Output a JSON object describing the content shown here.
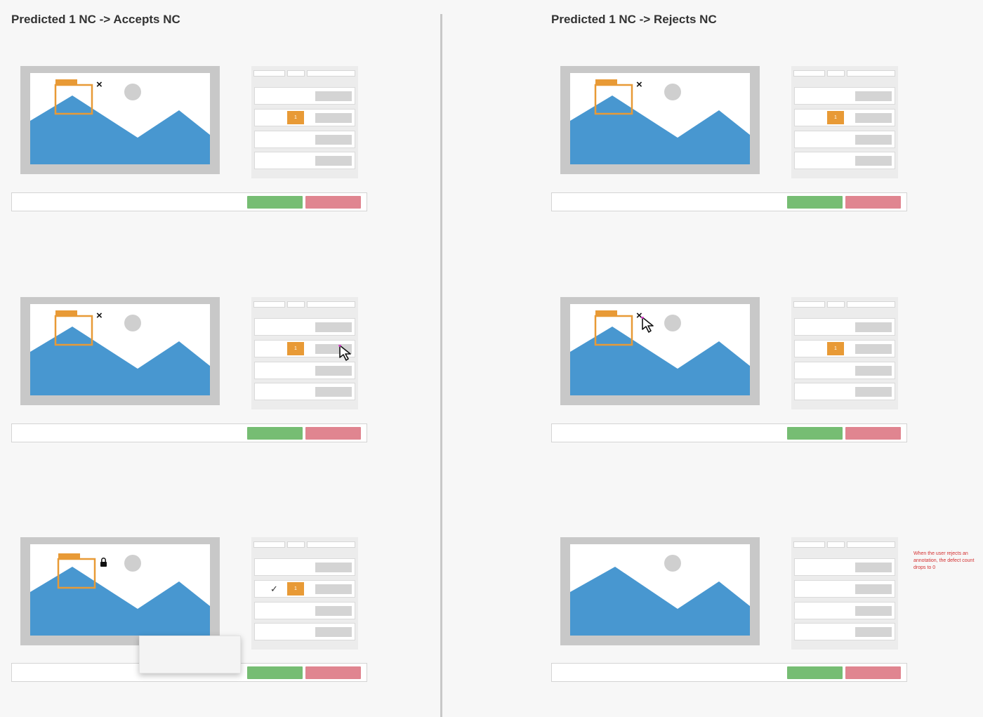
{
  "left_column": {
    "title": "Predicted 1 NC -> Accepts NC"
  },
  "right_column": {
    "title": "Predicted 1 NC -> Rejects NC"
  },
  "badge": {
    "label": "1"
  },
  "status_icons": {
    "close": "×",
    "check": "✓"
  },
  "annotation_note": {
    "text": "When the user rejects an annotation, the defect count drops to 0"
  },
  "colors": {
    "mountain": "#4897d0",
    "sun": "#cfcfcf",
    "annotation_box": "#e89a36",
    "accept_button": "#76bd73",
    "reject_button": "#e08590",
    "frame": "#c8c8c8",
    "note_text": "#d43030"
  }
}
